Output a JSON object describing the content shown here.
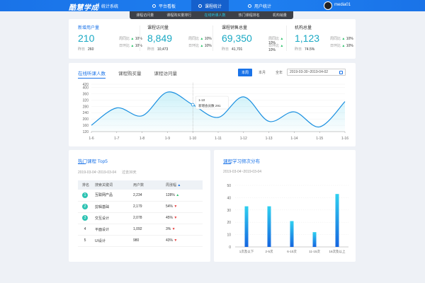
{
  "topbar": {
    "logo": "酷慧学成",
    "system": "统计系统",
    "nav": [
      {
        "label": "平台看板",
        "active": false
      },
      {
        "label": "课程统计",
        "active": true
      },
      {
        "label": "用户统计",
        "active": false
      }
    ],
    "username": "media01"
  },
  "subnav": [
    "课程访问量",
    "课程购买量排行",
    "在线听课人数",
    "热门课程排名",
    "机构销量"
  ],
  "kpis": [
    {
      "title": "新增用户量",
      "value": "210",
      "prev_label": "昨日",
      "prev_value": "260",
      "week_label": "周同比",
      "week_value": "10%",
      "week_dir": "up",
      "day_label": "日环比",
      "day_value": "10%",
      "day_dir": "up"
    },
    {
      "title": "课程访问量",
      "value": "8,849",
      "prev_label": "昨日",
      "prev_value": "10,473",
      "week_label": "周同比",
      "week_value": "10%",
      "week_dir": "up",
      "day_label": "日环比",
      "day_value": "10%",
      "day_dir": "up"
    },
    {
      "title": "课程销售总量",
      "value": "69,350",
      "prev_label": "昨日",
      "prev_value": "41,701",
      "week_label": "周同比",
      "week_value": "10%",
      "week_dir": "up",
      "day_label": "日环比",
      "day_value": "10%",
      "day_dir": "up"
    },
    {
      "title": "机构总量",
      "value": "1,123",
      "prev_label": "昨日",
      "prev_value": "74.5%",
      "week_label": "周同比",
      "week_value": "10%",
      "week_dir": "up",
      "day_label": "日环比",
      "day_value": "10%",
      "day_dir": "up"
    }
  ],
  "line_card": {
    "tabs": [
      "在线听课人数",
      "课程购买量",
      "课程访问量"
    ],
    "ranges": [
      "本周",
      "本月",
      "全年"
    ],
    "date_range": "2019-03-30~2019-04-02",
    "tooltip": {
      "date": "1-10",
      "label": "新增会员数",
      "value": "291"
    }
  },
  "hot_courses": {
    "title": "热门课程 Top5",
    "date": "2019-03-04~2019-03-04",
    "sub": "过去30天",
    "headers": [
      "排名",
      "搜索关键词",
      "用户数",
      "周涨幅"
    ],
    "rows": [
      {
        "rank": "1",
        "keyword": "互联网产品",
        "users": "2,234",
        "growth": "128%",
        "dir": "up"
      },
      {
        "rank": "2",
        "keyword": "剪辑基础",
        "users": "2,179",
        "growth": "54%",
        "dir": "down"
      },
      {
        "rank": "3",
        "keyword": "交互设计",
        "users": "2,078",
        "growth": "45%",
        "dir": "down"
      },
      {
        "rank": "4",
        "keyword": "平面设计",
        "users": "1,092",
        "growth": "3%",
        "dir": "down"
      },
      {
        "rank": "5",
        "keyword": "UI设计",
        "users": "980",
        "growth": "43%",
        "dir": "down"
      }
    ]
  },
  "dist_card": {
    "title": "课程学习频次分布",
    "date": "2019-03-04~2019-03-04"
  },
  "colors": {
    "accent": "#1a73e8",
    "teal": "#1aa9c4",
    "up": "#2cc36b",
    "down": "#e94040"
  },
  "chart_data": [
    {
      "type": "line",
      "x": [
        "1-6",
        "1-7",
        "1-8",
        "1-9",
        "1-10",
        "1-11",
        "1-12",
        "1-13",
        "1-14",
        "1-15",
        "1-16"
      ],
      "values": [
        160,
        270,
        220,
        370,
        290,
        210,
        340,
        185,
        245,
        150,
        310
      ],
      "yticks": [
        120,
        160,
        200,
        240,
        280,
        320,
        360,
        400,
        420
      ],
      "ylim": [
        120,
        420
      ]
    },
    {
      "type": "bar",
      "categories": [
        "1次及以下",
        "2-5次",
        "6-10次",
        "11-15次",
        "16次及以上"
      ],
      "values": [
        33,
        33,
        21,
        12,
        43
      ],
      "ylim": [
        0,
        50
      ],
      "yticks": [
        0,
        10,
        20,
        30,
        40,
        50
      ]
    }
  ]
}
